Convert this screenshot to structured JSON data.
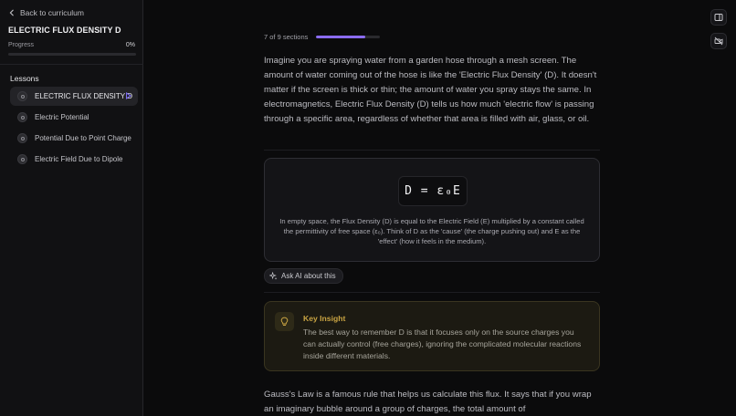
{
  "sidebar": {
    "back_label": "Back to curriculum",
    "course_title": "ELECTRIC FLUX DENSITY D",
    "progress_label": "Progress",
    "progress_value": "0%",
    "progress_fraction": 0,
    "lessons_heading": "Lessons",
    "lessons": [
      {
        "label": "ELECTRIC FLUX DENSITY D",
        "active": true
      },
      {
        "label": "Electric Potential",
        "active": false
      },
      {
        "label": "Potential Due to Point Charge",
        "active": false
      },
      {
        "label": "Electric Field Due to Dipole",
        "active": false
      }
    ]
  },
  "toolbar": {
    "icons": [
      "sidebar-toggle-icon",
      "video-off-icon"
    ]
  },
  "content": {
    "section_counter": "7 of 9 sections",
    "section_progress_fraction": 0.778,
    "intro_paragraph": "Imagine you are spraying water from a garden hose through a mesh screen. The amount of water coming out of the hose is like the 'Electric Flux Density' (D). It doesn't matter if the screen is thick or thin; the amount of water you spray stays the same. In electromagnetics, Electric Flux Density (D) tells us how much 'electric flow' is passing through a specific area, regardless of whether that area is filled with air, glass, or oil.",
    "formula": "D = ε₀E",
    "formula_caption": "In empty space, the Flux Density (D) is equal to the Electric Field (E) multiplied by a constant called the permittivity of free space (ε₀). Think of D as the 'cause' (the charge pushing out) and E as the 'effect' (how it feels in the medium).",
    "ask_ai_label": "Ask AI about this",
    "insight_title": "Key Insight",
    "insight_body": "The best way to remember D is that it focuses only on the source charges you can actually control (free charges), ignoring the complicated molecular reactions inside different materials.",
    "gauss_paragraph": "Gauss's Law is a famous rule that helps us calculate this flux. It says that if you wrap an imaginary bubble around a group of charges, the total amount of"
  },
  "colors": {
    "accent": "#8b6cf6",
    "insight_title": "#c9a443",
    "background": "#0b0b0c",
    "sidebar_bg": "#111113"
  }
}
